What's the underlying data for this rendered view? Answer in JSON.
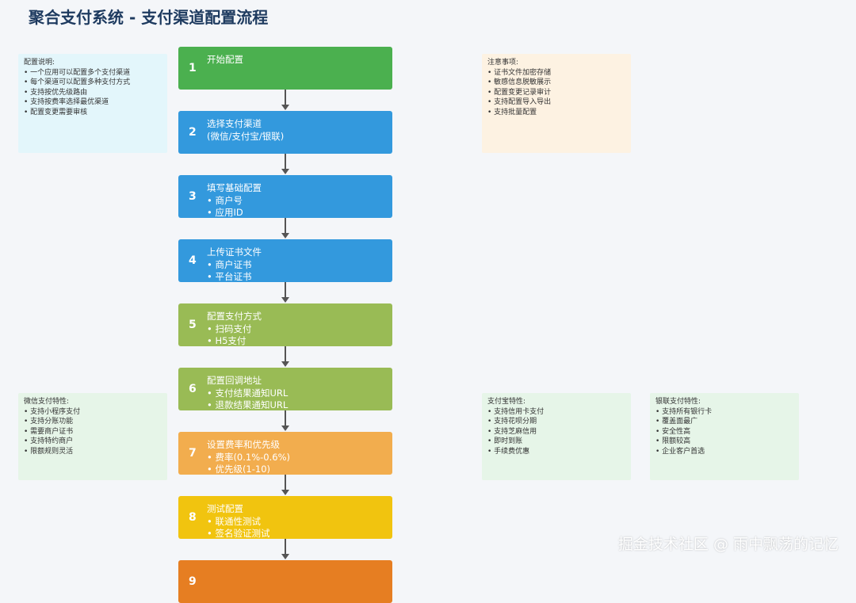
{
  "title": "聚合支付系统 - 支付渠道配置流程",
  "steps": [
    {
      "num": "1",
      "lines": [
        "开始配置"
      ],
      "color": "#4bb04f"
    },
    {
      "num": "2",
      "lines": [
        "选择支付渠道",
        "(微信/支付宝/银联)"
      ],
      "color": "#3399dd"
    },
    {
      "num": "3",
      "lines": [
        "填写基础配置",
        "• 商户号",
        "• 应用ID"
      ],
      "color": "#3399dd"
    },
    {
      "num": "4",
      "lines": [
        "上传证书文件",
        "• 商户证书",
        "• 平台证书"
      ],
      "color": "#3399dd"
    },
    {
      "num": "5",
      "lines": [
        "配置支付方式",
        "• 扫码支付",
        "• H5支付"
      ],
      "color": "#99bb55"
    },
    {
      "num": "6",
      "lines": [
        "配置回调地址",
        "• 支付结果通知URL",
        "• 退款结果通知URL"
      ],
      "color": "#99bb55"
    },
    {
      "num": "7",
      "lines": [
        "设置费率和优先级",
        "• 费率(0.1%-0.6%)",
        "• 优先级(1-10)"
      ],
      "color": "#f2ad4e"
    },
    {
      "num": "8",
      "lines": [
        "测试配置",
        "• 联通性测试",
        "• 签名验证测试"
      ],
      "color": "#f1c40f"
    },
    {
      "num": "9",
      "lines": [],
      "color": "#e67e22"
    }
  ],
  "notes": {
    "config": {
      "title": "配置说明:",
      "items": [
        "• 一个应用可以配置多个支付渠道",
        "• 每个渠道可以配置多种支付方式",
        "• 支持按优先级路由",
        "• 支持按费率选择最优渠道",
        "• 配置变更需要审核"
      ],
      "bg": "#e3f6fb"
    },
    "attention": {
      "title": "注意事项:",
      "items": [
        "• 证书文件加密存储",
        "• 敏感信息脱敏展示",
        "• 配置变更记录审计",
        "• 支持配置导入导出",
        "• 支持批量配置"
      ],
      "bg": "#fdf2e2"
    },
    "wechat": {
      "title": "微信支付特性:",
      "items": [
        "• 支持小程序支付",
        "• 支持分账功能",
        "• 需要商户证书",
        "• 支持特约商户",
        "• 限额规则灵活"
      ],
      "bg": "#e6f5e8"
    },
    "alipay": {
      "title": "支付宝特性:",
      "items": [
        "• 支持信用卡支付",
        "• 支持花呗分期",
        "• 支持芝麻信用",
        "• 即时到账",
        "• 手续费优惠"
      ],
      "bg": "#e6f5e8"
    },
    "unionpay": {
      "title": "银联支付特性:",
      "items": [
        "• 支持所有银行卡",
        "• 覆盖面最广",
        "• 安全性高",
        "• 限额较高",
        "• 企业客户首选"
      ],
      "bg": "#e6f5e8"
    }
  },
  "watermark": "掘金技术社区 @ 雨中飘荡的记忆"
}
